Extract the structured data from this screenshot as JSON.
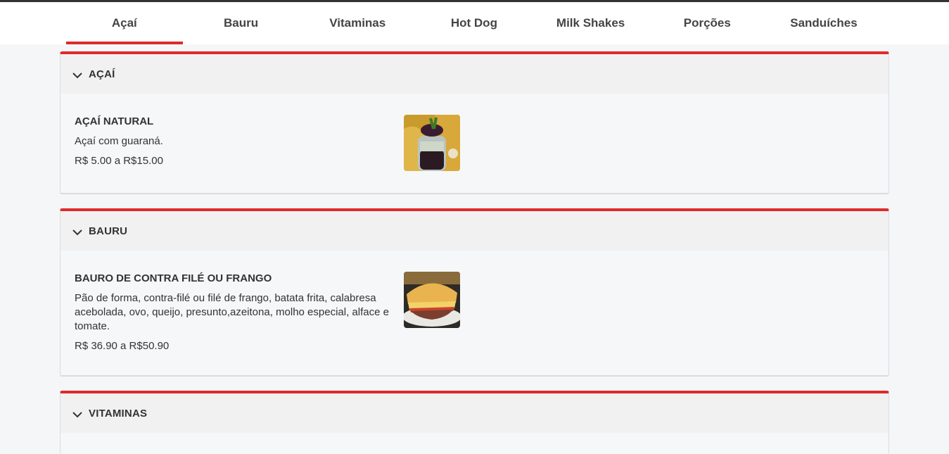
{
  "tabs": [
    {
      "label": "Açaí",
      "active": true
    },
    {
      "label": "Bauru",
      "active": false
    },
    {
      "label": "Vitaminas",
      "active": false
    },
    {
      "label": "Hot Dog",
      "active": false
    },
    {
      "label": "Milk Shakes",
      "active": false
    },
    {
      "label": "Porções",
      "active": false
    },
    {
      "label": "Sanduíches",
      "active": false
    }
  ],
  "sections": [
    {
      "title": "AÇAÍ",
      "item": {
        "name": "AÇAÍ NATURAL",
        "description": "Açaí com guaraná.",
        "price": "R$ 5.00 a R$15.00"
      }
    },
    {
      "title": "BAURU",
      "item": {
        "name": "BAURO DE CONTRA FILÉ OU FRANGO",
        "description": "Pão de forma, contra-filé ou filé de frango, batata frita, calabresa acebolada, ovo, queijo, presunto,azeitona, molho especial, alface e tomate.",
        "price": "R$ 36.90 a R$50.90"
      }
    },
    {
      "title": "VITAMINAS"
    }
  ],
  "colors": {
    "accent": "#e02a2a",
    "background": "#f5f6f8"
  },
  "icons": {
    "section_toggle": "chevron-down-icon"
  }
}
